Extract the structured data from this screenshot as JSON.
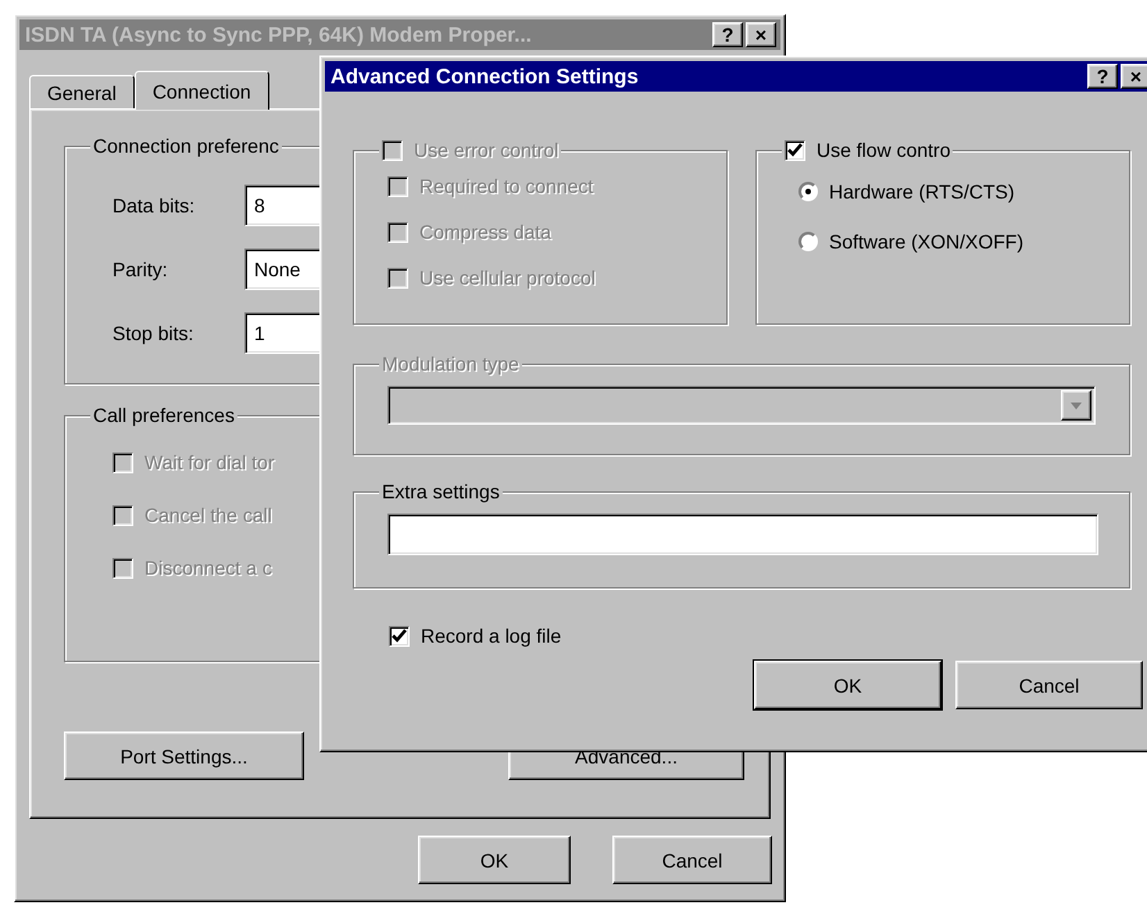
{
  "back_window": {
    "title": "ISDN TA (Async to Sync PPP, 64K) Modem Proper...",
    "active": false,
    "title_buttons": [
      "?",
      "×"
    ],
    "tabs": [
      {
        "label": "General",
        "selected": false
      },
      {
        "label": "Connection",
        "selected": true
      }
    ],
    "connection_preferences": {
      "title": "Connection preferenc",
      "fields": [
        {
          "label": "Data bits:",
          "value": "8"
        },
        {
          "label": "Parity:",
          "value": "None"
        },
        {
          "label": "Stop bits:",
          "value": "1"
        }
      ]
    },
    "call_preferences": {
      "title": "Call preferences",
      "options": [
        {
          "label": "Wait for dial tor",
          "checked": false,
          "disabled": true
        },
        {
          "label": "Cancel the call",
          "checked": false,
          "disabled": true
        },
        {
          "label": "Disconnect a c",
          "checked": false,
          "disabled": true
        }
      ]
    },
    "buttons": [
      "Port Settings...",
      "Advanced..."
    ],
    "footer_buttons": [
      "OK",
      "Cancel"
    ]
  },
  "front_window": {
    "title": "Advanced Connection Settings",
    "active": true,
    "title_buttons": [
      "?",
      "×"
    ],
    "error_control": {
      "label": "Use error control",
      "checked": false,
      "disabled": true,
      "options": [
        {
          "label": "Required to connect",
          "checked": false,
          "disabled": true
        },
        {
          "label": "Compress data",
          "checked": false,
          "disabled": true
        },
        {
          "label": "Use cellular protocol",
          "checked": false,
          "disabled": true
        }
      ]
    },
    "flow_control": {
      "label": "Use flow contro",
      "checked": true,
      "disabled": false,
      "options": [
        {
          "label": "Hardware (RTS/CTS)",
          "selected": true
        },
        {
          "label": "Software (XON/XOFF)",
          "selected": false
        }
      ]
    },
    "modulation_type": {
      "label": "Modulation type",
      "disabled": true
    },
    "extra_settings": {
      "label": "Extra settings"
    },
    "record_log": {
      "label": "Record a log file",
      "checked": true
    },
    "buttons": [
      "OK",
      "Cancel"
    ]
  }
}
